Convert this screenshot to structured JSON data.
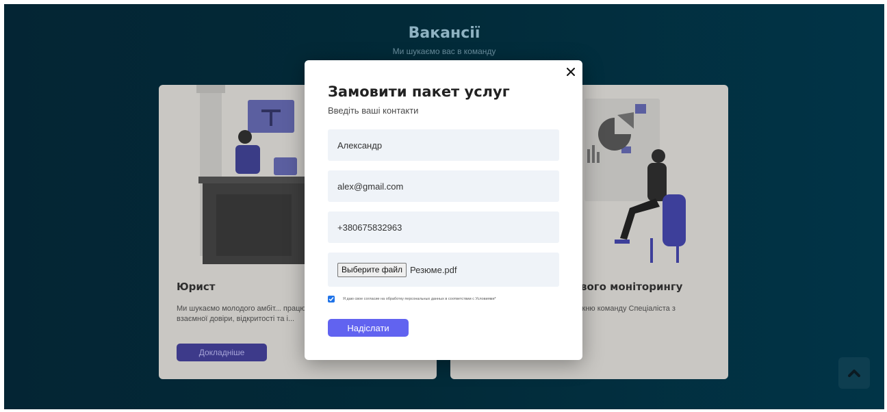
{
  "page": {
    "title": "Вакансії",
    "subtitle": "Ми шукаємо вас в команду"
  },
  "cards": [
    {
      "title": "Юрист",
      "text": "Ми шукаємо молодого амбіт... працювати в динамічному сере... взаємної довіри, відкритості та і...",
      "button_label": "Докладніше",
      "illustration": "lawyer-illustration"
    },
    {
      "title": "вого моніторингу",
      "text": "жню команду Спеціаліста з",
      "illustration": "analyst-illustration"
    }
  ],
  "modal": {
    "title": "Замовити пакет услуг",
    "subtitle": "Введіть ваші контакти",
    "fields": {
      "name": "Александр",
      "email": "alex@gmail.com",
      "phone": "+380675832963"
    },
    "file": {
      "button_label": "Выберите файл",
      "file_name": "Резюме.pdf"
    },
    "consent": {
      "checked": true,
      "text": "Я даю свое согласие на обработку персональных данных в соответствии с Условиями*"
    },
    "submit_label": "Надіслати",
    "close_icon": "close-icon"
  },
  "scroll_top_icon": "chevron-up-icon",
  "colors": {
    "accent": "#6163f0",
    "background": "#022a38",
    "field_bg": "#eff3f8"
  }
}
